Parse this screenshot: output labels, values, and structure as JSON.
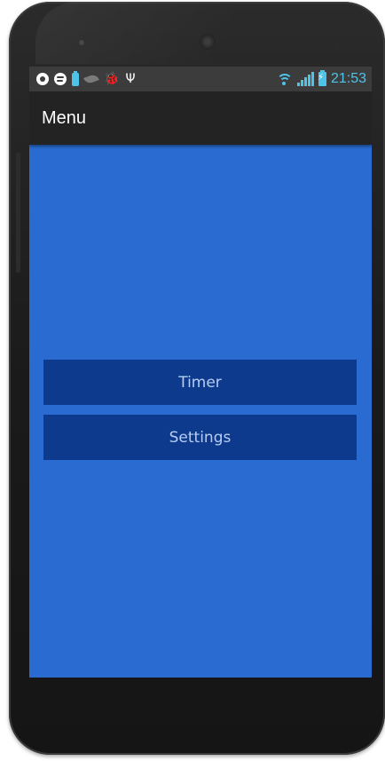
{
  "status_bar": {
    "icons_left": [
      "at-icon",
      "spotify-icon",
      "battery-widget-icon",
      "leaf-icon",
      "bug-icon",
      "usb-icon"
    ],
    "icons_right": [
      "wifi-icon",
      "signal-icon",
      "battery-charging-icon"
    ],
    "time": "21:53",
    "accent_color": "#4dc4e8"
  },
  "action_bar": {
    "title": "Menu"
  },
  "menu": {
    "items": [
      {
        "label": "Timer"
      },
      {
        "label": "Settings"
      }
    ],
    "button_color": "#0d3a8c",
    "button_text_color": "#b7cdf4"
  },
  "theme": {
    "background_color": "#2a6bd1",
    "action_bar_color": "#232323"
  }
}
